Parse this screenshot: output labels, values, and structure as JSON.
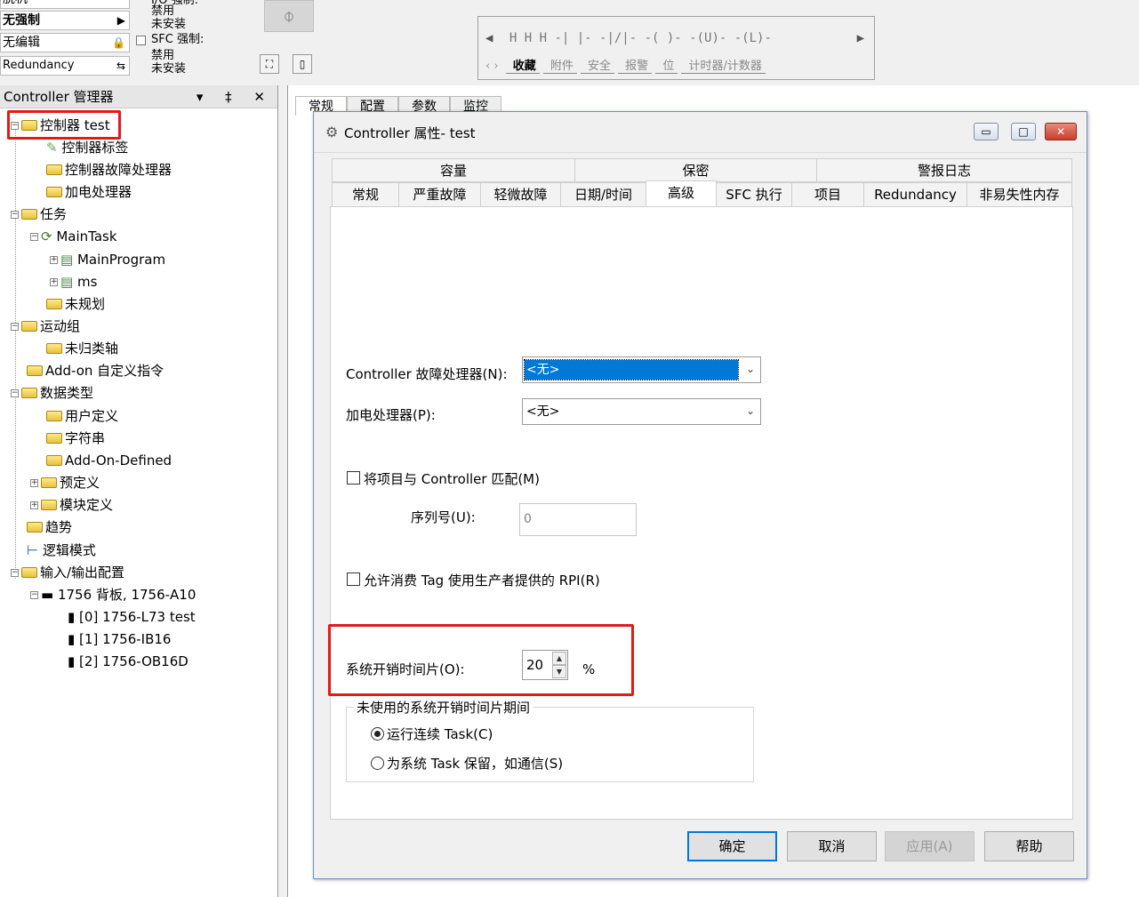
{
  "toolbar": {
    "mode_rows": [
      "脱机",
      "无强制",
      "无编辑",
      "Redundancy"
    ],
    "mode_icons": [
      "arrow-right",
      "lock",
      "redundancy"
    ],
    "forces_label": "I/O 强制:",
    "forces_states": [
      "禁用",
      "未安装"
    ],
    "sfc_label": "SFC 强制:",
    "sfc_states": [
      "禁用",
      "未安装"
    ],
    "instr_row": "H  H  H   -| |-  -|/|-  -( )-  -(U)-  -(L)-",
    "instr_tabs": [
      "收藏",
      "附件",
      "安全",
      "报警",
      "位",
      "计时器/计数器"
    ]
  },
  "organizer": {
    "title": "Controller 管理器",
    "header_controls": "▾ ‡ ✕",
    "items": [
      "控制器 test",
      "控制器标签",
      "控制器故障处理器",
      "加电处理器",
      "任务",
      "MainTask",
      "MainProgram",
      "ms",
      "未规划",
      "运动组",
      "未归类轴",
      "Add-on 自定义指令",
      "数据类型",
      "用户定义",
      "字符串",
      "Add-On-Defined",
      "预定义",
      "模块定义",
      "趋势",
      "逻辑模式",
      "输入/输出配置",
      "1756 背板, 1756-A10",
      "[0] 1756-L73 test",
      "[1] 1756-IB16",
      "[2] 1756-OB16D"
    ]
  },
  "workspace": {
    "tabs": [
      "常规",
      "配置",
      "参数",
      "监控"
    ]
  },
  "dialog": {
    "title": "Controller 属性- test",
    "tabs_top": [
      "容量",
      "保密",
      "警报日志"
    ],
    "tabs_bottom": [
      "常规",
      "严重故障",
      "轻微故障",
      "日期/时间",
      "高级",
      "SFC 执行",
      "项目",
      "Redundancy",
      "非易失性内存"
    ],
    "active_tab": "高级",
    "fault_handler_label": "Controller 故障处理器(N):",
    "fault_handler_value": "<无>",
    "powerup_label": "加电处理器(P):",
    "powerup_value": "<无>",
    "match_project_label": "将项目与 Controller 匹配(M)",
    "match_project_checked": false,
    "serial_label": "序列号(U):",
    "serial_value": "0",
    "allow_rpi_label": "允许消费 Tag 使用生产者提供的 RPI(R)",
    "allow_rpi_checked": false,
    "overhead_label": "系统开销时间片(O):",
    "overhead_value": "20",
    "overhead_unit": "%",
    "unused_group_label": "未使用的系统开销时间片期间",
    "radio_continuous": "运行连续 Task(C)",
    "radio_reserve": "为系统 Task 保留，如通信(S)",
    "selected_radio": "continuous",
    "buttons": {
      "ok": "确定",
      "cancel": "取消",
      "apply": "应用(A)",
      "help": "帮助"
    },
    "window_buttons": {
      "minimize": "▭",
      "maximize": "□",
      "close": "✕"
    }
  },
  "colors": {
    "highlight": "#e4191b",
    "selection": "#0078d7"
  }
}
